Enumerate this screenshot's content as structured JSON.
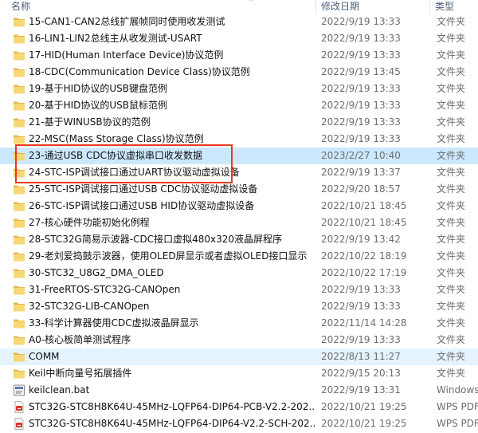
{
  "columns": {
    "name": "名称",
    "modified": "修改日期",
    "type": "类型"
  },
  "rows": [
    {
      "name": "15-CAN1-CAN2总线扩展帧同时使用收发测试",
      "date": "2022/9/19 13:33",
      "type": "文件夹",
      "icon": "folder-icon"
    },
    {
      "name": "16-LIN1-LIN2总线主从收发测试-USART",
      "date": "2022/9/19 13:33",
      "type": "文件夹",
      "icon": "folder-icon"
    },
    {
      "name": "17-HID(Human Interface Device)协议范例",
      "date": "2022/9/19 13:33",
      "type": "文件夹",
      "icon": "folder-icon"
    },
    {
      "name": "18-CDC(Communication Device Class)协议范例",
      "date": "2022/9/19 13:45",
      "type": "文件夹",
      "icon": "folder-icon"
    },
    {
      "name": "19-基于HID协议的USB键盘范例",
      "date": "2022/9/19 13:33",
      "type": "文件夹",
      "icon": "folder-icon"
    },
    {
      "name": "20-基于HID协议的USB鼠标范例",
      "date": "2022/9/19 13:33",
      "type": "文件夹",
      "icon": "folder-icon"
    },
    {
      "name": "21-基于WINUSB协议的范例",
      "date": "2022/9/19 13:33",
      "type": "文件夹",
      "icon": "folder-icon"
    },
    {
      "name": "22-MSC(Mass Storage Class)协议范例",
      "date": "2022/9/19 13:33",
      "type": "文件夹",
      "icon": "folder-icon"
    },
    {
      "name": "23-通过USB CDC协议虚拟串口收发数据",
      "date": "2023/2/27 10:40",
      "type": "文件夹",
      "icon": "folder-icon",
      "state": "selected"
    },
    {
      "name": "24-STC-ISP调试接口通过UART协议驱动虚拟设备",
      "date": "2022/9/19 13:37",
      "type": "文件夹",
      "icon": "folder-icon"
    },
    {
      "name": "25-STC-ISP调试接口通过USB CDC协议驱动虚拟设备",
      "date": "2022/9/20 18:57",
      "type": "文件夹",
      "icon": "folder-icon"
    },
    {
      "name": "26-STC-ISP调试接口通过USB HID协议驱动虚拟设备",
      "date": "2022/10/21 18:45",
      "type": "文件夹",
      "icon": "folder-icon"
    },
    {
      "name": "27-核心硬件功能初始化例程",
      "date": "2022/10/21 18:45",
      "type": "文件夹",
      "icon": "folder-icon"
    },
    {
      "name": "28-STC32G简易示波器-CDC接口虚拟480x320液晶屏程序",
      "date": "2022/9/19 13:42",
      "type": "文件夹",
      "icon": "folder-icon"
    },
    {
      "name": "29-老刘爱捣鼓示波器，使用OLED屏显示或者虚拟OLED接口显示",
      "date": "2022/10/22 18:19",
      "type": "文件夹",
      "icon": "folder-icon"
    },
    {
      "name": "30-STC32_U8G2_DMA_OLED",
      "date": "2022/10/22 17:19",
      "type": "文件夹",
      "icon": "folder-icon"
    },
    {
      "name": "31-FreeRTOS-STC32G-CANOpen",
      "date": "2022/9/19 13:33",
      "type": "文件夹",
      "icon": "folder-icon"
    },
    {
      "name": "32-STC32G-LIB-CANOpen",
      "date": "2022/9/19 13:33",
      "type": "文件夹",
      "icon": "folder-icon"
    },
    {
      "name": "33-科学计算器使用CDC虚拟液晶屏显示",
      "date": "2022/11/14 14:28",
      "type": "文件夹",
      "icon": "folder-icon"
    },
    {
      "name": "A0-核心板简单测试程序",
      "date": "2022/9/19 13:33",
      "type": "文件夹",
      "icon": "folder-icon"
    },
    {
      "name": "COMM",
      "date": "2022/8/13 11:27",
      "type": "文件夹",
      "icon": "folder-icon",
      "state": "hover"
    },
    {
      "name": "Keil中断向量号拓展插件",
      "date": "2022/9/15 20:13",
      "type": "文件夹",
      "icon": "folder-icon"
    },
    {
      "name": "keilclean.bat",
      "date": "2022/9/19 13:31",
      "type": "Windows",
      "icon": "bat-file-icon"
    },
    {
      "name": "STC32G-STC8H8K64U-45MHz-LQFP64-DIP64-PCB-V2.2-202...",
      "date": "2022/10/21 19:25",
      "type": "WPS PDF",
      "icon": "pdf-file-icon"
    },
    {
      "name": "STC32G-STC8H8K64U-45MHz-LQFP64-DIP64-V2.2-SCH-202...",
      "date": "2022/10/21 19:25",
      "type": "WPS PDF",
      "icon": "pdf-file-icon"
    }
  ]
}
